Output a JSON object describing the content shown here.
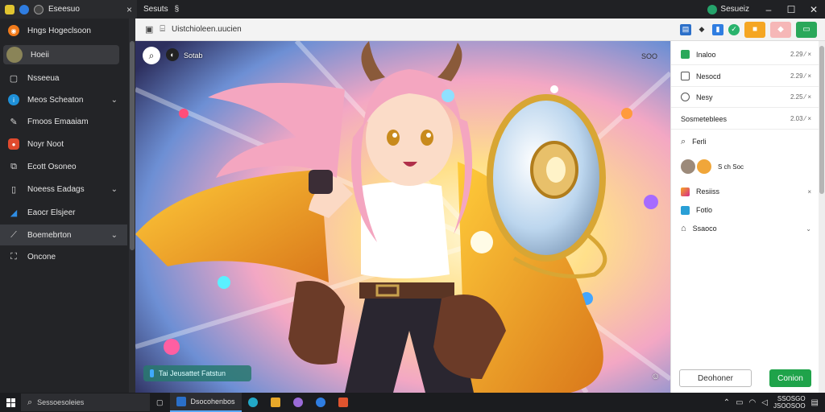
{
  "titlebar": {
    "tab_label": "Eseesuo",
    "tab_close": "×",
    "mid_label": "Sesuts",
    "mid_sep": "§",
    "right_label": "Sesueiz"
  },
  "sidebar": {
    "header": "Hngs Hogeclsoon",
    "profile_label": "Hoeii",
    "items": [
      {
        "label": "Nsseeua",
        "icon": "file-icon",
        "chev": ""
      },
      {
        "label": "Meos Scheaton",
        "icon": "info-icon",
        "chev": "⌄"
      },
      {
        "label": "Fmoos Emaaiam",
        "icon": "pen-icon",
        "chev": ""
      },
      {
        "label": "Noyr Noot",
        "icon": "tag-icon",
        "chev": ""
      },
      {
        "label": "Ecott Osoneo",
        "icon": "copy-icon",
        "chev": ""
      },
      {
        "label": "Noeess Eadags",
        "icon": "page-icon",
        "chev": "⌄"
      },
      {
        "label": "Eaocr Elsjeer",
        "icon": "blue-leaf-icon",
        "chev": ""
      },
      {
        "label": "Boemebrton",
        "icon": "brush-icon",
        "chev": "⌄"
      },
      {
        "label": "Oncone",
        "icon": "bag-icon",
        "chev": ""
      }
    ]
  },
  "apphead": {
    "path": "Uistchioleen.uucien"
  },
  "canvas": {
    "search_label": "Sotab",
    "top_right_text": "SOO",
    "status_text": "Tai Jeusattet Fatstun",
    "colors": {
      "hair": "#f4a6c0",
      "cape": "#f2a41c",
      "shirt": "#ffffff",
      "pants": "#2a2630"
    }
  },
  "rpanel": {
    "rows": [
      {
        "label": "Inaloo",
        "value": "2.29 ⁄ ×",
        "icon": "green-square-icon"
      },
      {
        "label": "Nesocd",
        "value": "2.29 ⁄ ×",
        "icon": "note-icon"
      },
      {
        "label": "Nesy",
        "value": "2.25 ⁄ ×",
        "icon": "comment-icon"
      },
      {
        "label": "Sosmeteblees",
        "value": "2.03 ⁄ ×",
        "icon": ""
      },
      {
        "label": "Ferli",
        "value": "",
        "icon": "search-icon"
      },
      {
        "label": "S ch Soc",
        "value": "",
        "icon": "avatars-icon"
      },
      {
        "label": "Resiiss",
        "value": "×",
        "icon": "instagram-icon"
      },
      {
        "label": "Fotlo",
        "value": "",
        "icon": "image-icon"
      },
      {
        "label": "Ssaoco",
        "value": "⌄",
        "icon": "pin-icon"
      }
    ],
    "cancel_label": "Deohoner",
    "confirm_label": "Conion"
  },
  "taskbar": {
    "search_placeholder": "Sessoesoleies",
    "active_app": "Dsocohenbos",
    "clock_line1": "SSOSGO",
    "clock_line2": "JSOOSOO"
  }
}
